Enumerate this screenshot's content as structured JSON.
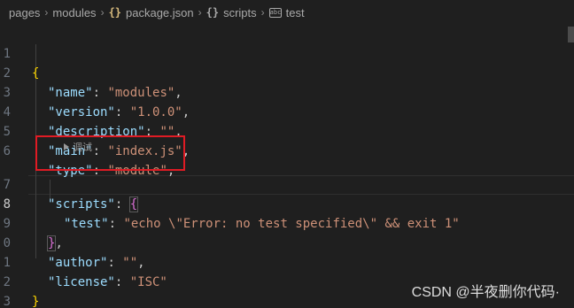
{
  "breadcrumb": {
    "items": [
      "pages",
      "modules",
      "package.json",
      "scripts",
      "test"
    ],
    "braces_glyph": "{}",
    "method_glyph": "abc",
    "separator": "›"
  },
  "editor": {
    "line_numbers": [
      "1",
      "2",
      "3",
      "4",
      "5",
      "6",
      "7",
      "8",
      "9",
      "0",
      "1",
      "2",
      "3"
    ],
    "codelens_label": "调试",
    "tokens": {
      "open_brace": "{",
      "close_brace": "}",
      "open_bracket": "{",
      "close_bracket": "}",
      "colon_space": ": ",
      "comma": ",",
      "name_key": "\"name\"",
      "name_val": "\"modules\"",
      "version_key": "\"version\"",
      "version_val": "\"1.0.0\"",
      "description_key": "\"description\"",
      "description_val": "\"\"",
      "main_key": "\"main\"",
      "main_val": "\"index.js\"",
      "type_key": "\"type\"",
      "type_val": "\"module\"",
      "scripts_key": "\"scripts\"",
      "test_key": "\"test\"",
      "test_val": "\"echo \\\"Error: no test specified\\\" && exit 1\"",
      "author_key": "\"author\"",
      "author_val": "\"\"",
      "license_key": "\"license\"",
      "license_val": "\"ISC\""
    }
  },
  "watermark": "CSDN @半夜删你代码·",
  "colors": {
    "background": "#1f1f1f",
    "key": "#9cdcfe",
    "string": "#ce9178",
    "bracket_level1": "#ffd700",
    "bracket_level2": "#da70d6",
    "highlight_box": "#e01b24"
  }
}
